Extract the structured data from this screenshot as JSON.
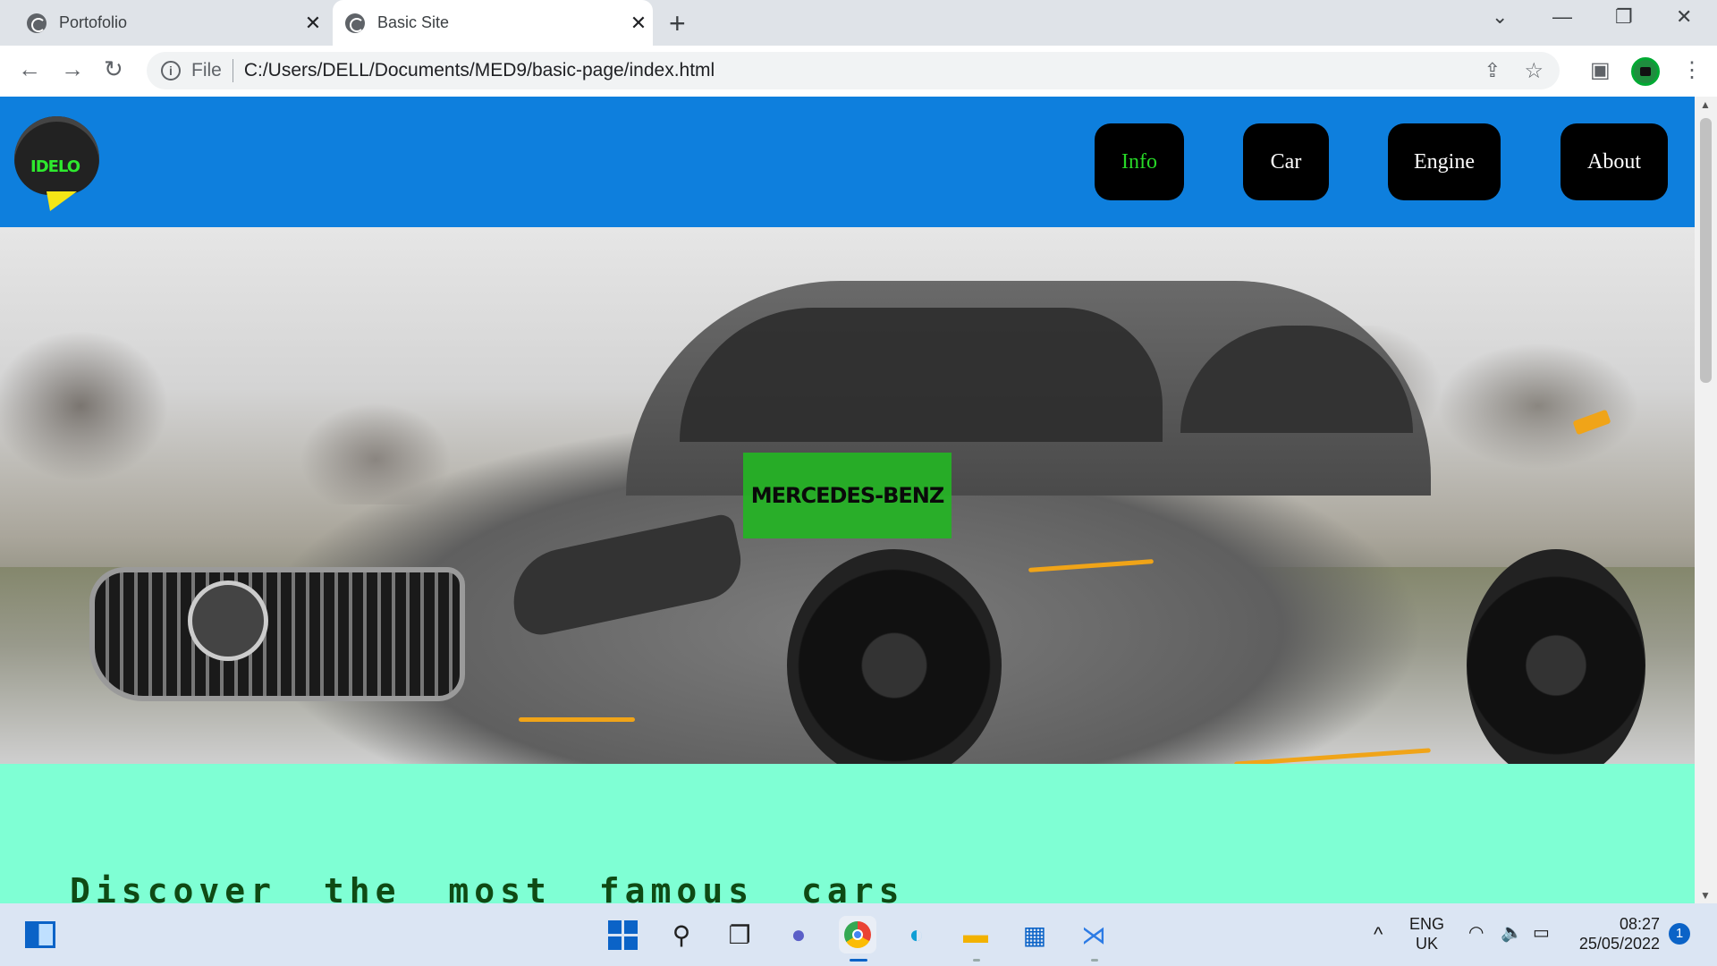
{
  "browser": {
    "tabs": [
      {
        "title": "Portofolio",
        "active": false
      },
      {
        "title": "Basic Site",
        "active": true
      }
    ],
    "new_tab": "+",
    "address": {
      "scheme_label": "File",
      "url": "C:/Users/DELL/Documents/MED9/basic-page/index.html"
    },
    "icons": [
      "back-icon",
      "forward-icon",
      "reload-icon",
      "info-icon",
      "share-icon",
      "star-icon",
      "side-panel-icon",
      "profile-avatar",
      "menu-icon"
    ]
  },
  "page": {
    "logo_text": "IDELO",
    "nav": [
      {
        "label": "Info",
        "active": true
      },
      {
        "label": "Car",
        "active": false
      },
      {
        "label": "Engine",
        "active": false
      },
      {
        "label": "About",
        "active": false
      }
    ],
    "hero_badge": "MERCEDES-BENZ",
    "section_heading": "Discover the most famous cars",
    "colors": {
      "header": "#0e7fdd",
      "nav_bg": "#000000",
      "nav_active": "#27d827",
      "badge": "#24b424",
      "section_bg": "#7fffd4",
      "heading": "#0f4a14"
    }
  },
  "taskbar": {
    "apps": [
      "start-icon",
      "search-icon",
      "task-view-icon",
      "teams-chat-icon",
      "chrome-icon",
      "edge-icon",
      "file-explorer-icon",
      "store-icon",
      "vscode-icon"
    ],
    "language": {
      "line1": "ENG",
      "line2": "UK"
    },
    "clock": {
      "time": "08:27",
      "date": "25/05/2022"
    },
    "notifications": "1"
  }
}
